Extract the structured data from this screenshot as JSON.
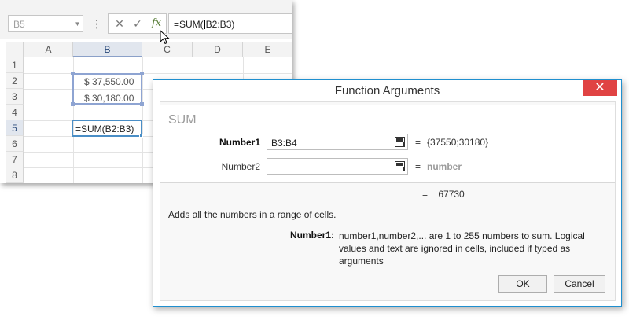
{
  "spreadsheet": {
    "name_box": "B5",
    "formula_buttons": {
      "cancel": "✕",
      "enter": "✓",
      "insert_function": "fx"
    },
    "formula_before_caret": "=SUM(",
    "formula_after_caret": "B2:B3)",
    "columns": [
      "A",
      "B",
      "C",
      "D",
      "E"
    ],
    "selected_column": "B",
    "rows": [
      "1",
      "2",
      "3",
      "4",
      "5",
      "6",
      "7",
      "8"
    ],
    "selected_row": "5",
    "cells": {
      "B2": "$ 37,550.00",
      "B3": "$ 30,180.00",
      "B5": "=SUM(B2:B3)"
    }
  },
  "dialog": {
    "title": "Function Arguments",
    "close_label": "✕",
    "function_name": "SUM",
    "args": [
      {
        "label": "Number1",
        "value": "B3:B4",
        "result": "{37550;30180}"
      },
      {
        "label": "Number2",
        "value": "",
        "result": "number"
      }
    ],
    "equals": "=",
    "total": "67730",
    "description": "Adds all the numbers in a range of cells.",
    "arg_desc_label": "Number1:",
    "arg_desc_text": "number1,number2,... are 1 to 255 numbers to sum. Logical values and text are ignored in cells, included if typed as arguments",
    "ok_label": "OK",
    "cancel_label": "Cancel"
  }
}
